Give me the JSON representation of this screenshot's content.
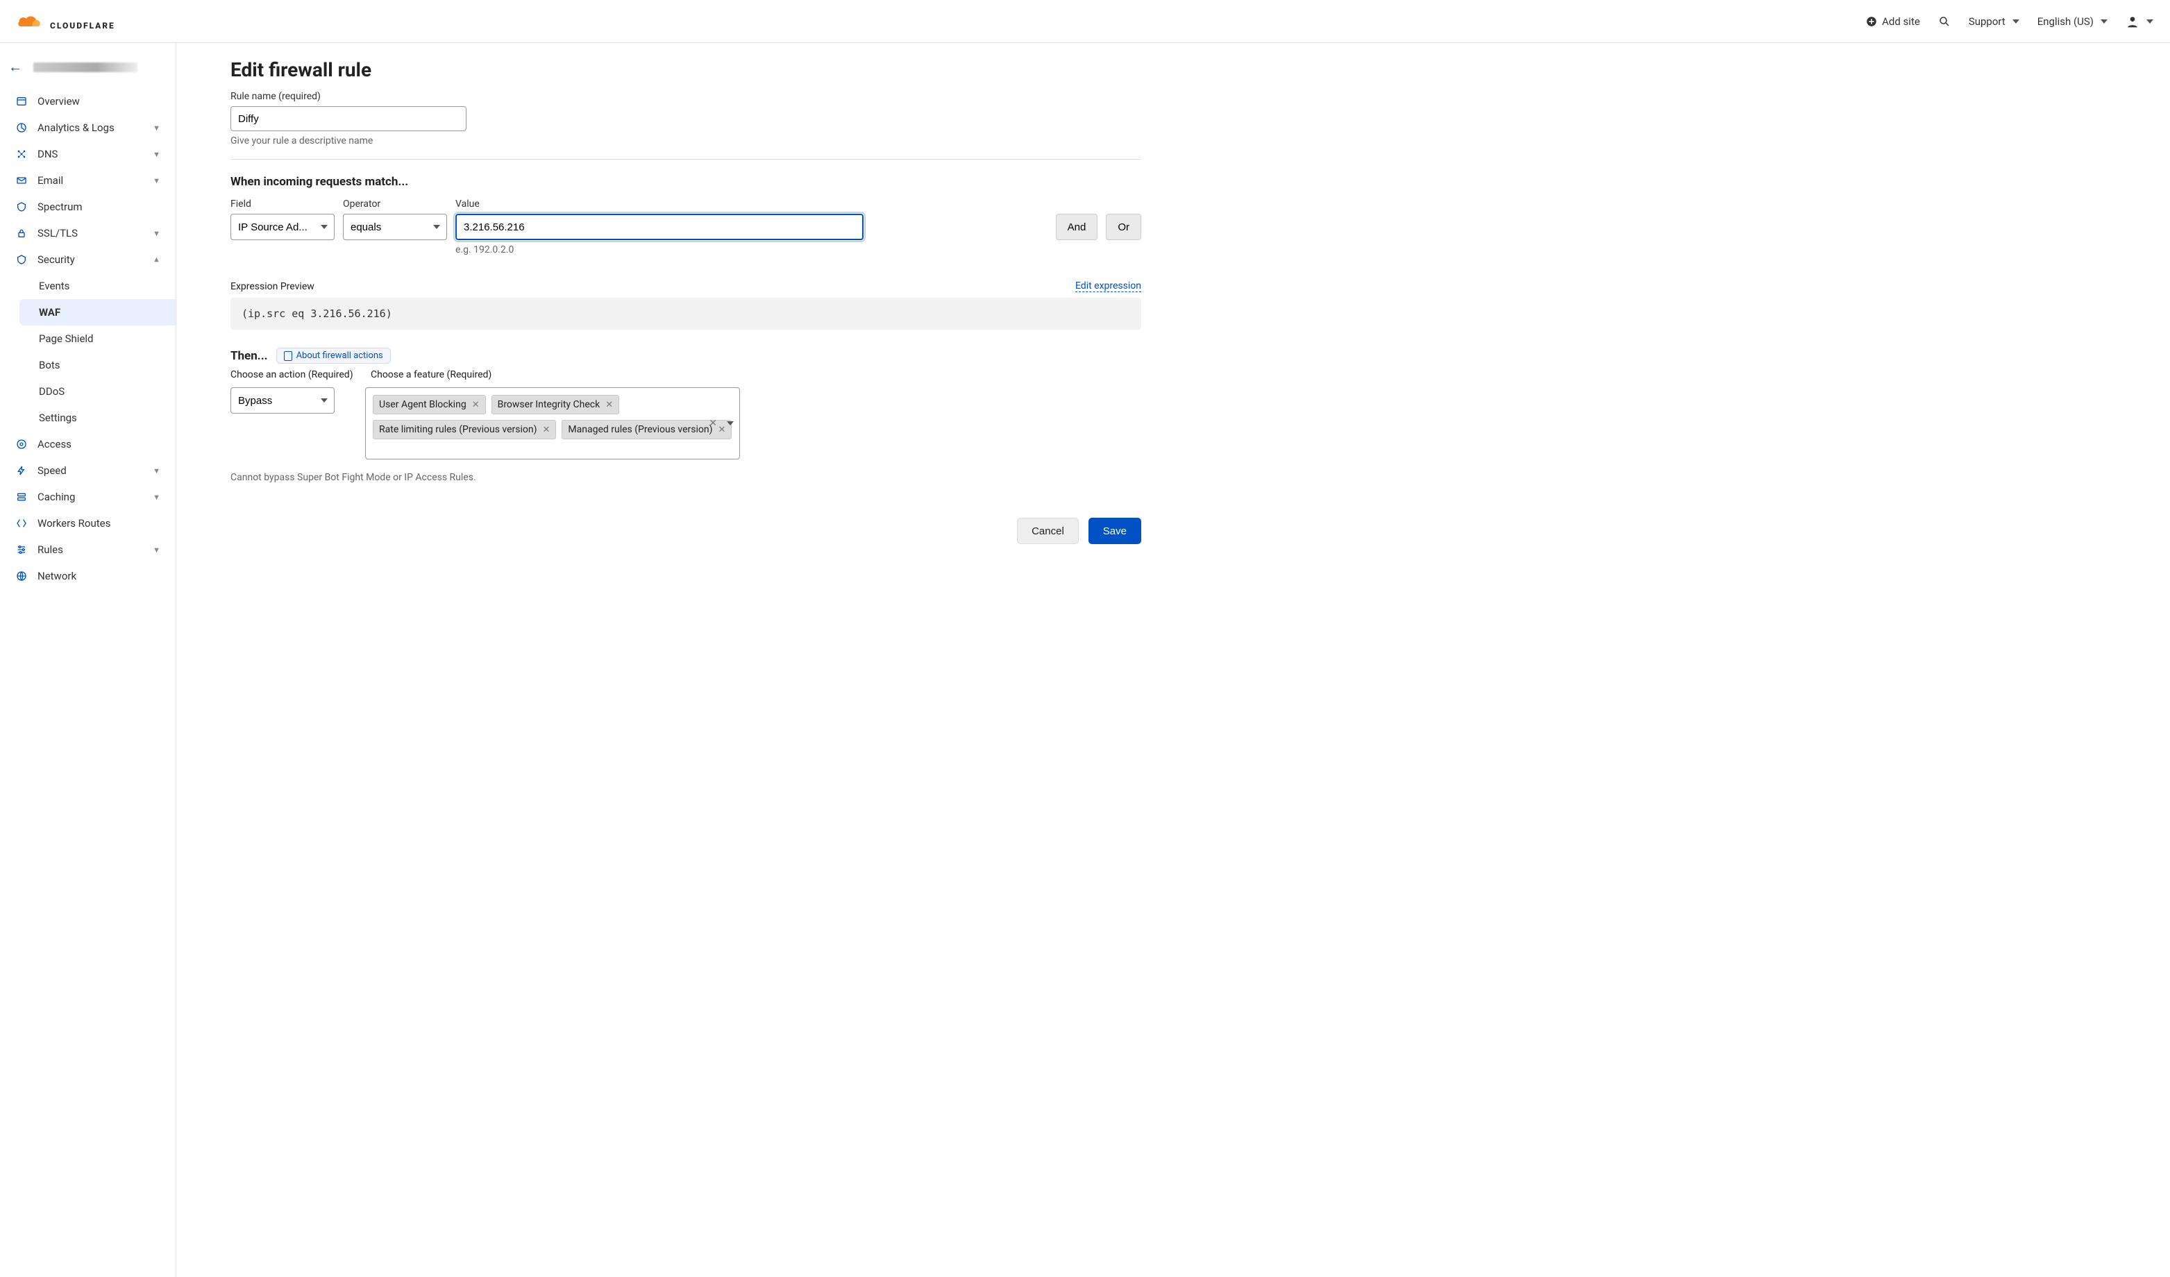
{
  "header": {
    "add_site": "Add site",
    "support": "Support",
    "language": "English (US)"
  },
  "logo_text": "CLOUDFLARE",
  "sidebar": {
    "items": [
      {
        "label": "Overview",
        "icon": "overview"
      },
      {
        "label": "Analytics & Logs",
        "icon": "analytics",
        "chev": true
      },
      {
        "label": "DNS",
        "icon": "dns",
        "chev": true
      },
      {
        "label": "Email",
        "icon": "email",
        "chev": true
      },
      {
        "label": "Spectrum",
        "icon": "spectrum"
      },
      {
        "label": "SSL/TLS",
        "icon": "ssl",
        "chev": true
      },
      {
        "label": "Security",
        "icon": "security",
        "chev": true,
        "expanded": true
      }
    ],
    "security_sub": [
      {
        "label": "Events"
      },
      {
        "label": "WAF",
        "active": true
      },
      {
        "label": "Page Shield"
      },
      {
        "label": "Bots"
      },
      {
        "label": "DDoS"
      },
      {
        "label": "Settings"
      }
    ],
    "items_after": [
      {
        "label": "Access",
        "icon": "access"
      },
      {
        "label": "Speed",
        "icon": "speed",
        "chev": true
      },
      {
        "label": "Caching",
        "icon": "caching",
        "chev": true
      },
      {
        "label": "Workers Routes",
        "icon": "workers"
      },
      {
        "label": "Rules",
        "icon": "rules",
        "chev": true
      },
      {
        "label": "Network",
        "icon": "network"
      }
    ]
  },
  "page": {
    "title": "Edit firewall rule",
    "rule_name_label": "Rule name (required)",
    "rule_name_value": "Diffy",
    "rule_name_hint": "Give your rule a descriptive name",
    "match_title": "When incoming requests match...",
    "field_label": "Field",
    "operator_label": "Operator",
    "value_label": "Value",
    "field_value": "IP Source Ad...",
    "operator_value": "equals",
    "value_value": "3.216.56.216",
    "value_placeholder": "e.g. 192.0.2.0",
    "and_btn": "And",
    "or_btn": "Or",
    "expr_preview_label": "Expression Preview",
    "edit_expression": "Edit expression",
    "expr_code": "(ip.src eq 3.216.56.216)",
    "then_title": "Then...",
    "about_actions": "About firewall actions",
    "choose_action_label": "Choose an action (Required)",
    "choose_feature_label": "Choose a feature (Required)",
    "action_value": "Bypass",
    "features": [
      "User Agent Blocking",
      "Browser Integrity Check",
      "Rate limiting rules (Previous version)",
      "Managed rules (Previous version)"
    ],
    "bypass_note": "Cannot bypass Super Bot Fight Mode or IP Access Rules.",
    "cancel": "Cancel",
    "save": "Save"
  }
}
